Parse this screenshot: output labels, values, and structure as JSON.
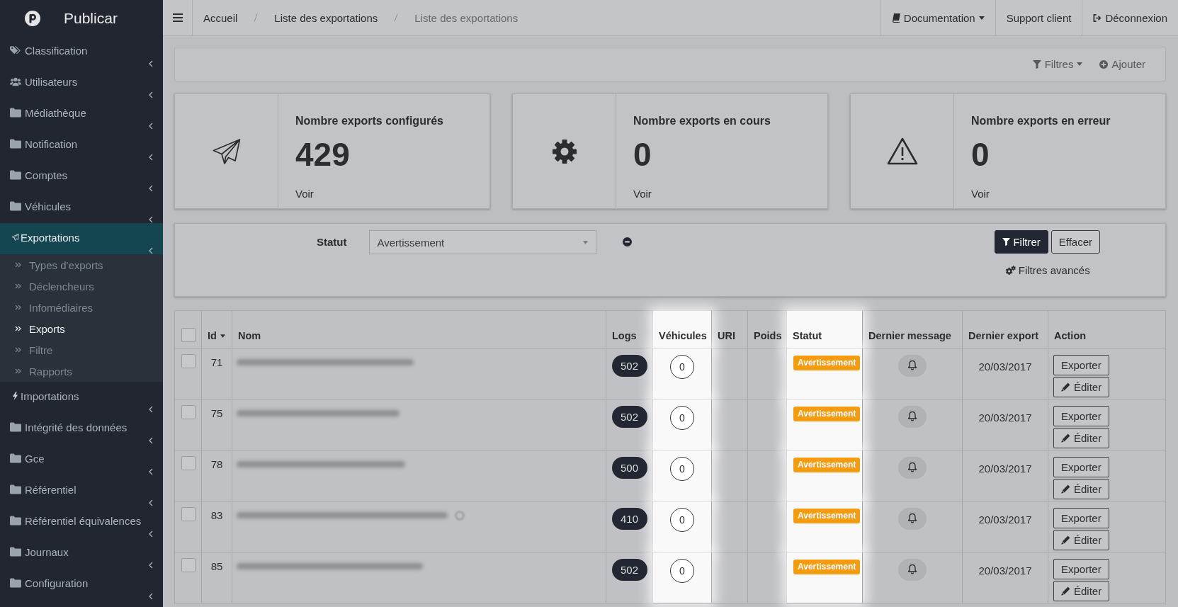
{
  "sidebar": {
    "brand": "Publicar",
    "items": [
      {
        "label": "Classification",
        "kind": "tags",
        "selected": false
      },
      {
        "label": "Utilisateurs",
        "kind": "users",
        "selected": false
      },
      {
        "label": "Médiathèque",
        "kind": "folder",
        "selected": false
      },
      {
        "label": "Notification",
        "kind": "folder",
        "selected": false
      },
      {
        "label": "Comptes",
        "kind": "folder",
        "selected": false
      },
      {
        "label": "Véhicules",
        "kind": "folder",
        "selected": false
      },
      {
        "label": "Exportations",
        "kind": "send",
        "selected": true,
        "children": [
          {
            "label": "Types d'exports",
            "selected": false
          },
          {
            "label": "Déclencheurs",
            "selected": false
          },
          {
            "label": "Infomédiaires",
            "selected": false
          },
          {
            "label": "Exports",
            "selected": true
          },
          {
            "label": "Filtre",
            "selected": false
          },
          {
            "label": "Rapports",
            "selected": false
          }
        ]
      },
      {
        "label": "Importations",
        "kind": "bolt",
        "selected": false
      },
      {
        "label": "Intégrité des données",
        "kind": "folder",
        "selected": false
      },
      {
        "label": "Gce",
        "kind": "folder",
        "selected": false
      },
      {
        "label": "Référentiel",
        "kind": "folder",
        "selected": false
      },
      {
        "label": "Référentiel équivalences",
        "kind": "folder",
        "selected": false
      },
      {
        "label": "Journaux",
        "kind": "folder",
        "selected": false
      },
      {
        "label": "Configuration",
        "kind": "folder",
        "selected": false
      }
    ]
  },
  "topbar": {
    "breadcrumb": [
      {
        "label": "Accueil",
        "current": false
      },
      {
        "label": "Liste des exportations",
        "current": false
      },
      {
        "label": "Liste des exportations",
        "current": true
      }
    ],
    "links": [
      {
        "label": "Documentation",
        "kind": "docs",
        "dropdown": true
      },
      {
        "label": "Support client",
        "kind": "support",
        "dropdown": false
      },
      {
        "label": "Déconnexion",
        "kind": "logout",
        "dropdown": false
      }
    ]
  },
  "toolbar": [
    {
      "label": "Filtres",
      "kind": "filter",
      "dropdown": true
    },
    {
      "label": "Ajouter",
      "kind": "add",
      "dropdown": false
    }
  ],
  "stats": [
    {
      "kind": "sent",
      "title": "Nombre exports configurés",
      "value": "429",
      "link": "Voir"
    },
    {
      "kind": "running",
      "title": "Nombre exports en cours",
      "value": "0",
      "link": "Voir"
    },
    {
      "kind": "error",
      "title": "Nombre exports en erreur",
      "value": "0",
      "link": "Voir"
    }
  ],
  "filter": {
    "label": "Statut",
    "value": "Avertissement",
    "buttons": [
      {
        "label": "Filtrer",
        "kind": "primary"
      },
      {
        "label": "Effacer",
        "kind": "default"
      }
    ],
    "advanced": "Filtres avancés"
  },
  "table": {
    "select_all": {
      "checked": false
    },
    "columns": [
      {
        "label": "Id",
        "sorted": true,
        "highlighted": false
      },
      {
        "label": "Nom",
        "sorted": false,
        "highlighted": false
      },
      {
        "label": "Logs",
        "sorted": false,
        "highlighted": false
      },
      {
        "label": "Véhicules",
        "sorted": false,
        "highlighted": true
      },
      {
        "label": "URI",
        "sorted": false,
        "highlighted": false
      },
      {
        "label": "Poids",
        "sorted": false,
        "highlighted": false
      },
      {
        "label": "Statut",
        "sorted": false,
        "highlighted": true
      },
      {
        "label": "Dernier message",
        "sorted": false,
        "highlighted": false
      },
      {
        "label": "Dernier export",
        "sorted": false,
        "highlighted": false
      },
      {
        "label": "Action",
        "sorted": false,
        "highlighted": false
      }
    ],
    "rows": [
      {
        "checked": false,
        "id": "71",
        "note_icon": false,
        "logs": "502",
        "vehicles": "0",
        "status": "Avertissement",
        "date": "20/03/2017",
        "actions": [
          {
            "label": "Exporter",
            "kind": "export"
          },
          {
            "label": "Éditer",
            "kind": "edit"
          }
        ]
      },
      {
        "checked": false,
        "id": "75",
        "note_icon": false,
        "logs": "502",
        "vehicles": "0",
        "status": "Avertissement",
        "date": "20/03/2017",
        "actions": [
          {
            "label": "Exporter",
            "kind": "export"
          },
          {
            "label": "Éditer",
            "kind": "edit"
          }
        ]
      },
      {
        "checked": false,
        "id": "78",
        "note_icon": false,
        "logs": "500",
        "vehicles": "0",
        "status": "Avertissement",
        "date": "20/03/2017",
        "actions": [
          {
            "label": "Exporter",
            "kind": "export"
          },
          {
            "label": "Éditer",
            "kind": "edit"
          }
        ]
      },
      {
        "checked": false,
        "id": "83",
        "note_icon": true,
        "logs": "410",
        "vehicles": "0",
        "status": "Avertissement",
        "date": "20/03/2017",
        "actions": [
          {
            "label": "Exporter",
            "kind": "export"
          },
          {
            "label": "Éditer",
            "kind": "edit"
          }
        ]
      },
      {
        "checked": false,
        "id": "85",
        "note_icon": false,
        "logs": "502",
        "vehicles": "0",
        "status": "Avertissement",
        "date": "20/03/2017",
        "actions": [
          {
            "label": "Exporter",
            "kind": "export"
          },
          {
            "label": "Éditer",
            "kind": "edit"
          }
        ]
      }
    ]
  }
}
